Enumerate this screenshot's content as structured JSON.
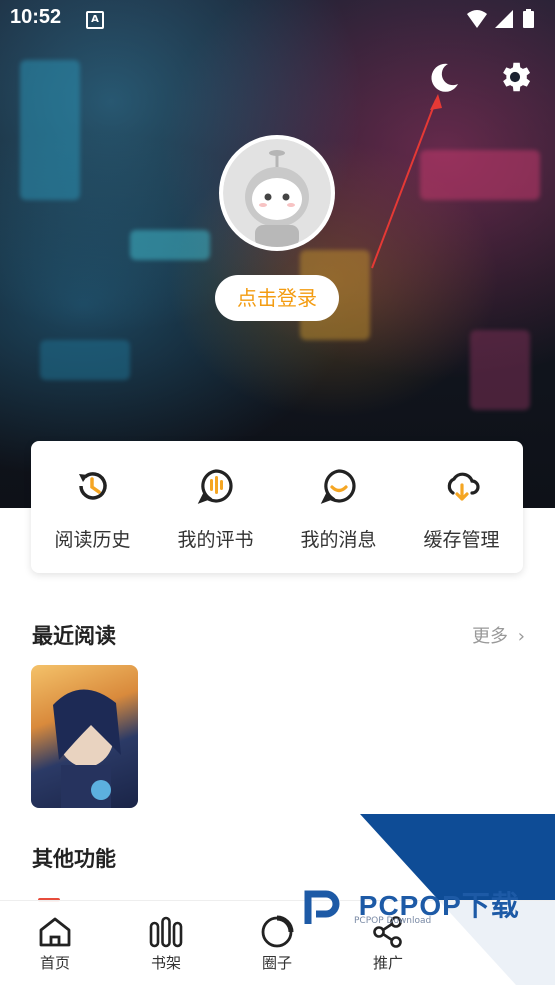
{
  "status_bar": {
    "time": "10:52",
    "a_badge": "A"
  },
  "profile": {
    "login_label": "点击登录"
  },
  "quick_menu": [
    {
      "label": "阅读历史",
      "icon": "history-icon"
    },
    {
      "label": "我的评书",
      "icon": "comment-book-icon"
    },
    {
      "label": "我的消息",
      "icon": "message-icon"
    },
    {
      "label": "缓存管理",
      "icon": "cloud-download-icon"
    }
  ],
  "recent": {
    "title": "最近阅读",
    "more": "更多"
  },
  "other": {
    "title": "其他功能"
  },
  "bottom_nav": [
    {
      "label": "首页",
      "icon": "home-icon"
    },
    {
      "label": "书架",
      "icon": "bookshelf-icon"
    },
    {
      "label": "圈子",
      "icon": "circle-icon"
    },
    {
      "label": "推广",
      "icon": "share-icon"
    }
  ],
  "watermark": {
    "brand": "PCPOP下载",
    "sub": "PCPOP Download"
  },
  "colors": {
    "accent": "#f39c12",
    "watermark_blue": "#0e4c96",
    "arrow_red": "#e53935"
  }
}
